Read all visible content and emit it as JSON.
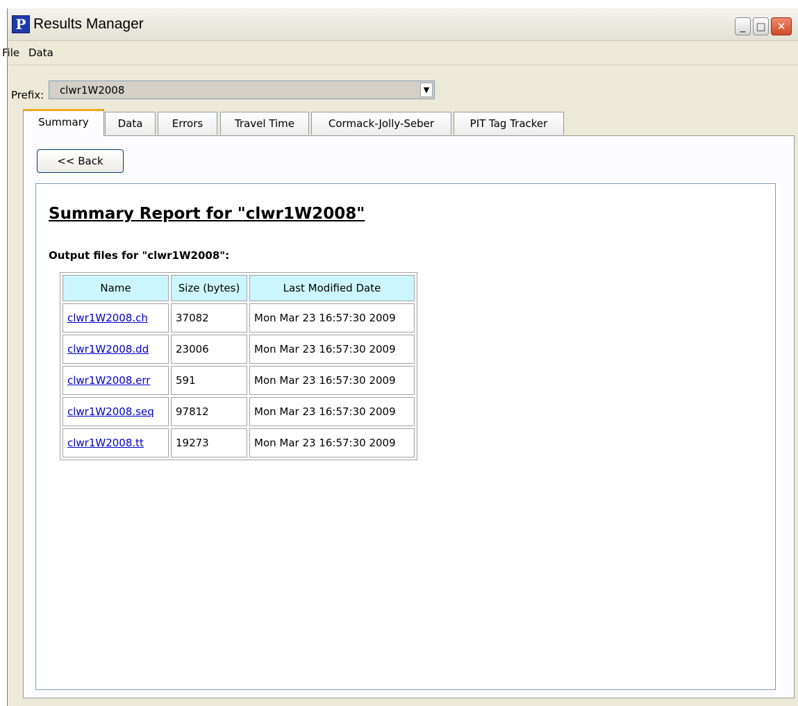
{
  "window": {
    "title": "Results Manager",
    "app_icon_letter": "P",
    "minimize_label": "_",
    "maximize_label": "□",
    "close_label": "✕"
  },
  "menu": [
    "File",
    "Data"
  ],
  "prefix": {
    "label": "Prefix:",
    "value": "clwr1W2008"
  },
  "tabs": [
    {
      "label": "Summary",
      "active": true
    },
    {
      "label": "Data"
    },
    {
      "label": "Errors"
    },
    {
      "label": "Travel Time"
    },
    {
      "label": "Cormack-Jolly-Seber"
    },
    {
      "label": "PIT Tag Tracker"
    }
  ],
  "back_button": "<< Back",
  "report": {
    "title": "Summary Report for \"clwr1W2008\"",
    "subheading": "Output files for \"clwr1W2008\":",
    "columns": [
      "Name",
      "Size (bytes)",
      "Last Modified Date"
    ],
    "rows": [
      {
        "name": "clwr1W2008.ch",
        "size": "37082",
        "date": "Mon Mar 23 16:57:30 2009"
      },
      {
        "name": "clwr1W2008.dd",
        "size": "23006",
        "date": "Mon Mar 23 16:57:30 2009"
      },
      {
        "name": "clwr1W2008.err",
        "size": "591",
        "date": "Mon Mar 23 16:57:30 2009"
      },
      {
        "name": "clwr1W2008.seq",
        "size": "97812",
        "date": "Mon Mar 23 16:57:30 2009"
      },
      {
        "name": "clwr1W2008.tt",
        "size": "19273",
        "date": "Mon Mar 23 16:57:30 2009"
      }
    ]
  },
  "colors": {
    "accent_tab": "#f3a81a",
    "table_header": "#ccf6ff",
    "link": "#0000cc"
  }
}
